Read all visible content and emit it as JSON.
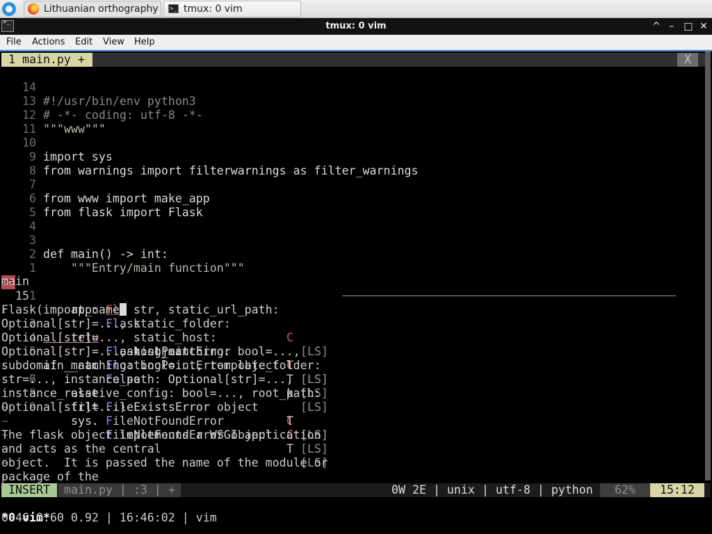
{
  "taskbar": {
    "tasks": [
      {
        "label": "Lithuanian orthography ..."
      },
      {
        "label": "tmux: 0 vim"
      }
    ]
  },
  "window": {
    "title": "tmux: 0 vim",
    "controls": [
      "^",
      "–",
      "□",
      "✕"
    ]
  },
  "menubar": {
    "items": [
      "File",
      "Actions",
      "Edit",
      "View",
      "Help"
    ]
  },
  "vim": {
    "tab_label": "1 main.py +",
    "tab_close": "X",
    "lines": [
      {
        "num": "14",
        "code": "#!/usr/bin/env python3"
      },
      {
        "num": "13",
        "code": "# -*- coding: utf-8 -*-"
      },
      {
        "num": "12",
        "code": "\"\"\"www\"\"\""
      },
      {
        "num": "11",
        "code": ""
      },
      {
        "num": "10",
        "code": "import sys"
      },
      {
        "num": "9",
        "code": "from warnings import filterwarnings as filter_warnings"
      },
      {
        "num": "8",
        "code": ""
      },
      {
        "num": "7",
        "code": "from www import make_app"
      },
      {
        "num": "6",
        "code": "from flask import Flask"
      },
      {
        "num": "5",
        "code": ""
      },
      {
        "num": "4",
        "code": ""
      },
      {
        "num": "3",
        "code": "def main() -> int:"
      },
      {
        "num": "2",
        "code": "    \"\"\"Entry/main function\"\"\""
      },
      {
        "num": "1",
        "code": ""
      }
    ],
    "current_line": {
      "sign": ">>",
      "num": "15",
      "prefix": "    app: ",
      "typed": "Fl"
    },
    "below_lines": [
      {
        "num": "1",
        "sign": "",
        "code": ""
      },
      {
        "num": "2",
        "sign": "⚠",
        "code": "    retu"
      },
      {
        "num": "3",
        "sign": "",
        "code": ""
      },
      {
        "num": "4",
        "sign": "",
        "code": ""
      },
      {
        "num": "5",
        "sign": "",
        "code": "if __nam"
      },
      {
        "num": "6",
        "sign": "⚠",
        "code": "    asse"
      },
      {
        "num": "7",
        "sign": "",
        "code": ""
      },
      {
        "num": "8",
        "sign": "",
        "code": "    filt"
      },
      {
        "num": "9",
        "sign": "",
        "code": "    sys."
      }
    ],
    "popup": [
      {
        "match": "Fl",
        "rest": "ask",
        "kind": "C",
        "source": "[LS]"
      },
      {
        "match": "Fl",
        "rest": "ask object",
        "kind": "T",
        "source": "[LS]"
      },
      {
        "match": "Fl",
        "rest": "oatingPointError",
        "kind": "C",
        "source": "[LS]"
      },
      {
        "match": "Fl",
        "rest": "oatingPointError object",
        "kind": "T",
        "source": "[LS]"
      },
      {
        "match": "Fa",
        "rest": "lse",
        "kind": "k",
        "source": "[LS]"
      },
      {
        "match": "F",
        "rest": "ileExistsError",
        "kind": "C",
        "source": "[LS]"
      },
      {
        "match": "F",
        "rest": "ileExistsError object",
        "kind": "T",
        "source": "[LS]"
      },
      {
        "match": "F",
        "rest": "ileNotFoundError",
        "kind": "C",
        "source": "[LS]"
      },
      {
        "match": "F",
        "rest": "ileNotFoundError object",
        "kind": "T",
        "source": "[LS]"
      }
    ],
    "preview": {
      "title": "main",
      "lines": [
        "Flask(import_name: str, static_url_path:",
        "Optional[str]=..., static_folder:",
        "Optional[str]=..., static_host:",
        "Optional[str]=..., host_matching: bool=...,",
        "subdomain_matching: bool=..., template_folder:",
        "str=..., instance_path: Optional[str]=...,",
        "instance_relative_config: bool=..., root_path:",
        "Optional[str]=...)",
        "",
        "The flask object implements a WSGI application",
        "and acts as the central",
        "object.  It is passed the name of the module or",
        "package of the"
      ]
    },
    "tildes": [
      "~",
      "~",
      "~",
      "~",
      "~",
      "~"
    ],
    "statusline": {
      "mode": "INSERT",
      "fileinfo": "main.py | :3 | +",
      "right": "0W 2E | unix | utf-8 | python",
      "percent": "62%",
      "position": "15:12"
    }
  },
  "tmux": {
    "left": "*0 vim*",
    "right": "0.46 0.60 0.92 | 16:46:02 | vim"
  }
}
